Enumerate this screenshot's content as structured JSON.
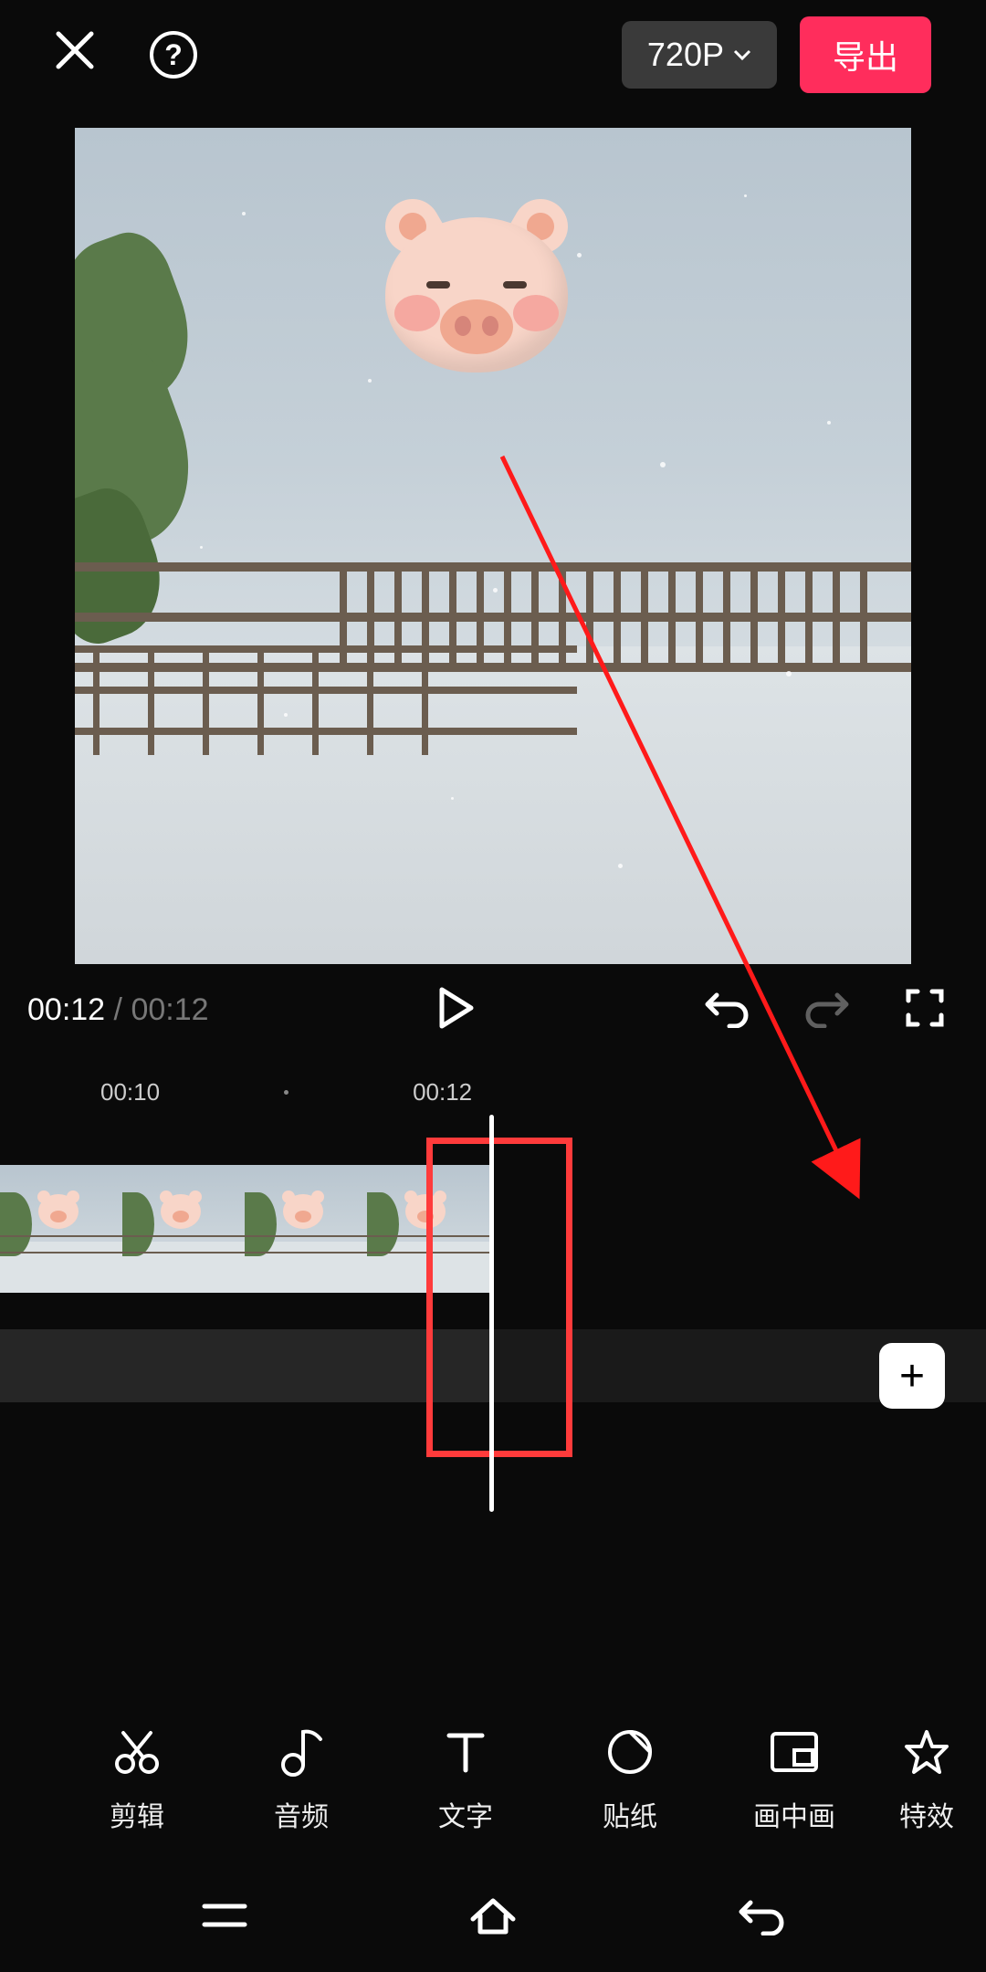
{
  "header": {
    "resolution": "720P",
    "export": "导出"
  },
  "playback": {
    "current_time": "00:12",
    "separator": " / ",
    "total_time": "00:12"
  },
  "ruler": {
    "marks": [
      "00:10",
      "00:12"
    ]
  },
  "add_button": "+",
  "toolbar": [
    {
      "id": "edit",
      "label": "剪辑"
    },
    {
      "id": "audio",
      "label": "音频"
    },
    {
      "id": "text",
      "label": "文字"
    },
    {
      "id": "sticker",
      "label": "贴纸"
    },
    {
      "id": "pip",
      "label": "画中画"
    },
    {
      "id": "effects",
      "label": "特效"
    }
  ]
}
